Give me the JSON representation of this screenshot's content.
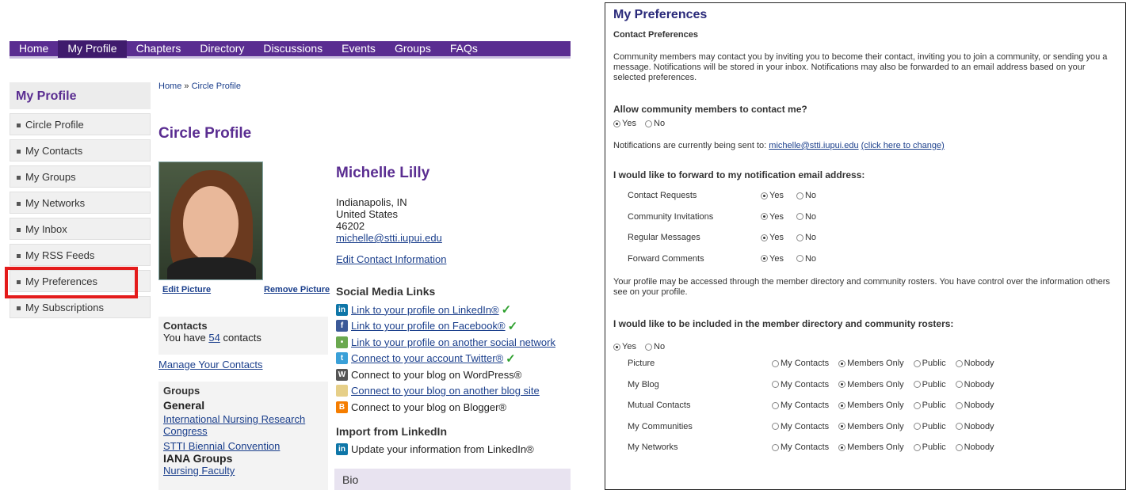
{
  "nav": {
    "items": [
      "Home",
      "My Profile",
      "Chapters",
      "Directory",
      "Discussions",
      "Events",
      "Groups",
      "FAQs"
    ],
    "active_index": 1
  },
  "sidebar": {
    "title": "My Profile",
    "items": [
      {
        "label": "Circle Profile"
      },
      {
        "label": "My Contacts"
      },
      {
        "label": "My Groups"
      },
      {
        "label": "My Networks"
      },
      {
        "label": "My Inbox"
      },
      {
        "label": "My RSS Feeds"
      },
      {
        "label": "My Preferences"
      },
      {
        "label": "My Subscriptions"
      }
    ]
  },
  "breadcrumb": {
    "home": "Home",
    "separator": "»",
    "current": "Circle Profile"
  },
  "page_title": "Circle Profile",
  "picture": {
    "edit": "Edit Picture",
    "remove": "Remove Picture"
  },
  "contacts": {
    "heading": "Contacts",
    "prefix": "You have",
    "count": "54",
    "suffix": "contacts",
    "manage": "Manage Your Contacts"
  },
  "groups": {
    "heading": "Groups",
    "general_label": "General",
    "general_items": [
      "International Nursing Research Congress",
      "STTI Biennial Convention"
    ],
    "iana_label": "IANA Groups",
    "iana_items": [
      "Nursing Faculty"
    ]
  },
  "profile": {
    "name": "Michelle Lilly",
    "city": "Indianapolis, IN",
    "country": "United States",
    "zip": "46202",
    "email": "michelle@stti.iupui.edu",
    "edit_contact": "Edit Contact Information"
  },
  "social": {
    "heading": "Social Media Links",
    "items": [
      {
        "icon": "linkedin-icon",
        "label": "Link to your profile on LinkedIn®",
        "linked": true,
        "checked": true,
        "color": "#0e76a8",
        "glyph": "in"
      },
      {
        "icon": "facebook-icon",
        "label": "Link to your profile on Facebook®",
        "linked": true,
        "checked": true,
        "color": "#3b5998",
        "glyph": "f"
      },
      {
        "icon": "social-network-icon",
        "label": "Link to your profile on another social network",
        "linked": true,
        "checked": false,
        "color": "#6aa84f",
        "glyph": "•"
      },
      {
        "icon": "twitter-icon",
        "label": "Connect to your account Twitter®",
        "linked": true,
        "checked": true,
        "color": "#3aa0d8",
        "glyph": "t"
      },
      {
        "icon": "wordpress-icon",
        "label": "Connect to your blog on WordPress®",
        "linked": false,
        "checked": false,
        "color": "#555555",
        "glyph": "W"
      },
      {
        "icon": "blog-icon",
        "label": "Connect to your blog on another blog site",
        "linked": true,
        "checked": false,
        "color": "#e6cf88",
        "glyph": ""
      },
      {
        "icon": "blogger-icon",
        "label": "Connect to your blog on Blogger®",
        "linked": false,
        "checked": false,
        "color": "#f57d00",
        "glyph": "B"
      }
    ]
  },
  "import": {
    "heading": "Import from LinkedIn",
    "label": "Update your information from LinkedIn®",
    "icon": "linkedin-icon"
  },
  "bio": {
    "label": "Bio"
  },
  "prefs": {
    "title": "My Preferences",
    "subtitle": "Contact Preferences",
    "intro": "Community members may contact you by inviting you to become their contact, inviting you to join a community, or sending you a message. Notifications will be stored in your inbox. Notifications may also be forwarded to an email address based on your selected preferences.",
    "allow_q": "Allow community members to contact me?",
    "yes": "Yes",
    "no": "No",
    "notif_prefix": "Notifications are currently being sent to:",
    "notif_email": "michelle@stti.iupui.edu",
    "notif_change": "(click here to change)",
    "forward_q": "I would like to forward to my notification email address:",
    "forward_rows": [
      "Contact Requests",
      "Community Invitations",
      "Regular Messages",
      "Forward Comments"
    ],
    "profile_para": "Your profile may be accessed through the member directory and community rosters. You have control over the information others see on your profile.",
    "directory_q": "I would like to be included in the member directory and community rosters:",
    "vis_options": [
      "My Contacts",
      "Members Only",
      "Public",
      "Nobody"
    ],
    "vis_rows": [
      "Picture",
      "My Blog",
      "Mutual Contacts",
      "My Communities",
      "My Networks"
    ]
  }
}
